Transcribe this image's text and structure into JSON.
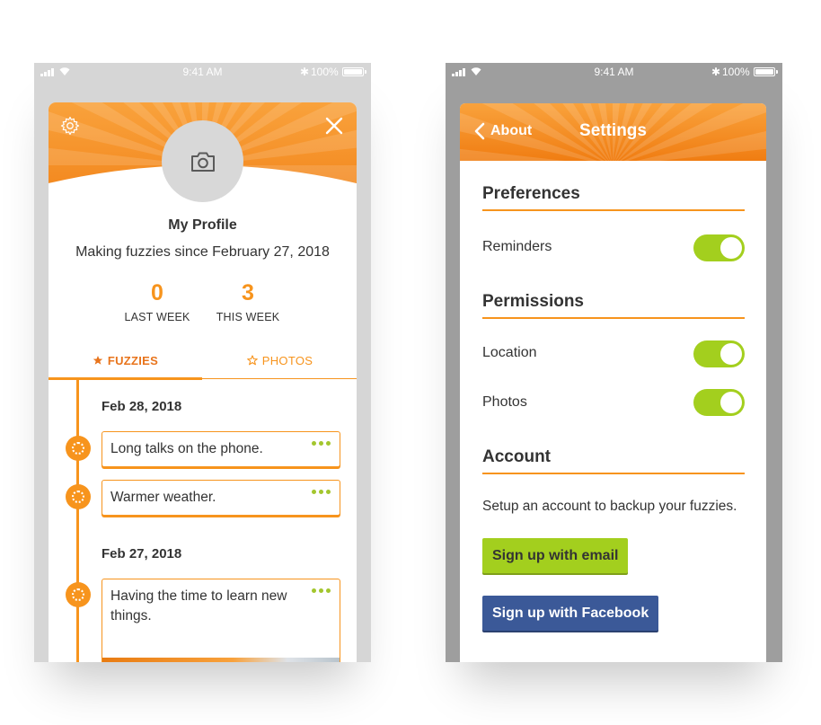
{
  "status_bar": {
    "time": "9:41 AM",
    "battery": "100%"
  },
  "profile": {
    "title": "My Profile",
    "since": "Making fuzzies since February 27, 2018",
    "stats": [
      {
        "value": "0",
        "label": "LAST WEEK"
      },
      {
        "value": "3",
        "label": "THIS WEEK"
      }
    ],
    "tabs": [
      {
        "label": "FUZZIES",
        "icon": "star-filled-icon",
        "active": true
      },
      {
        "label": "PHOTOS",
        "icon": "star-outline-icon",
        "active": false
      }
    ],
    "timeline": [
      {
        "date": "Feb 28, 2018",
        "entries": [
          {
            "text": "Long talks on the phone."
          },
          {
            "text": "Warmer weather."
          }
        ]
      },
      {
        "date": "Feb 27, 2018",
        "entries": [
          {
            "text": "Having the time to learn new things."
          }
        ]
      }
    ]
  },
  "settings": {
    "back_label": "About",
    "title": "Settings",
    "sections": {
      "preferences": {
        "title": "Preferences",
        "rows": [
          {
            "label": "Reminders",
            "on": true
          }
        ]
      },
      "permissions": {
        "title": "Permissions",
        "rows": [
          {
            "label": "Location",
            "on": true
          },
          {
            "label": "Photos",
            "on": true
          }
        ]
      },
      "account": {
        "title": "Account",
        "text": "Setup an account to backup your fuzzies.",
        "email_button": "Sign up with email",
        "facebook_button": "Sign up with Facebook"
      }
    }
  },
  "colors": {
    "accent_orange": "#f7941d",
    "toggle_green": "#a3cf1e",
    "facebook_blue": "#3b5998"
  }
}
